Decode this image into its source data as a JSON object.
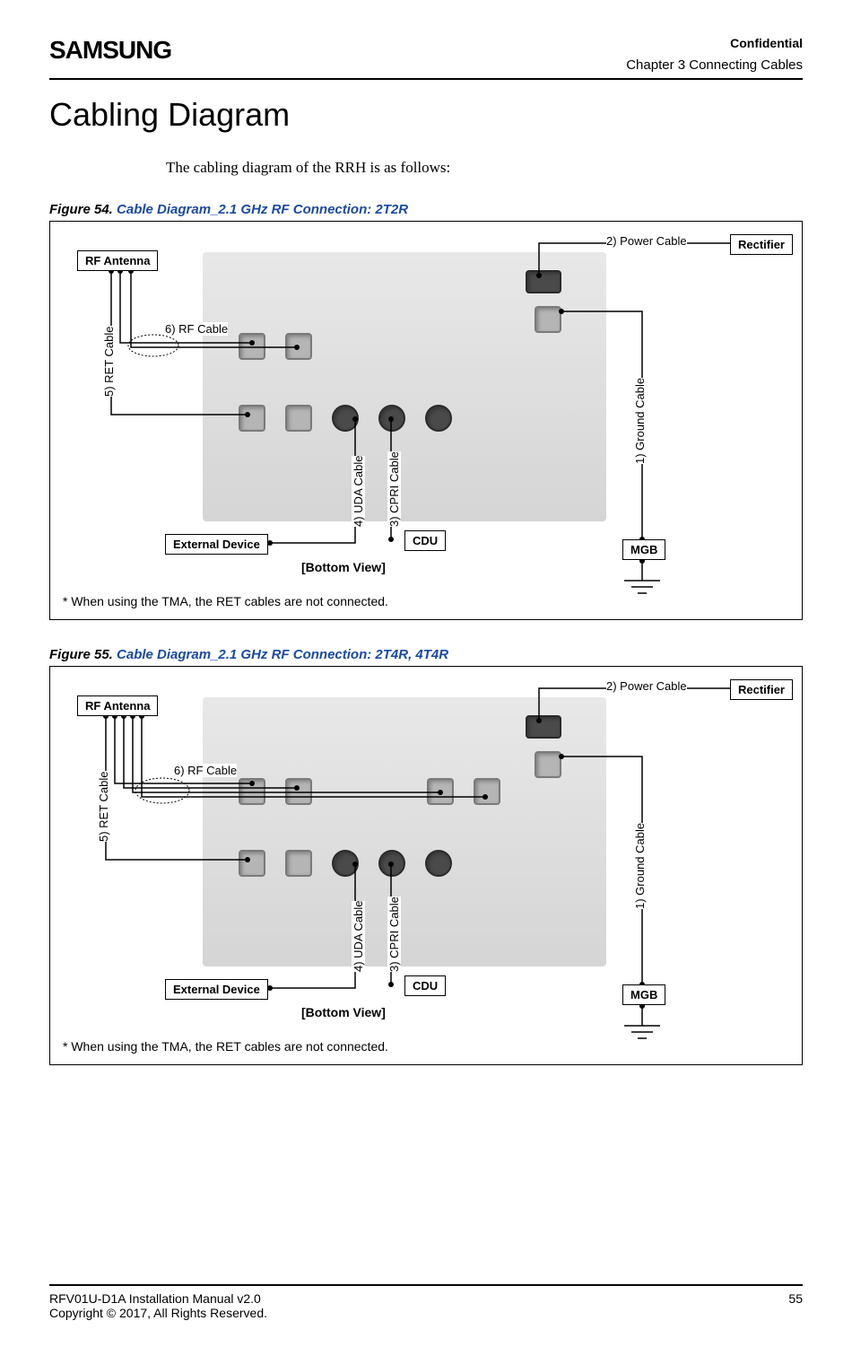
{
  "header": {
    "logo": "SAMSUNG",
    "confidential": "Confidential",
    "chapter": "Chapter 3 Connecting Cables"
  },
  "title": "Cabling Diagram",
  "intro": "The cabling diagram of the RRH is as follows:",
  "figures": [
    {
      "prefix": "Figure 54.",
      "title": "Cable Diagram_2.1 GHz RF Connection: 2T2R",
      "labels": {
        "rf_antenna": "RF Antenna",
        "rectifier": "Rectifier",
        "external_device": "External Device",
        "cdu": "CDU",
        "mgb": "MGB",
        "power_cable": "2)  Power Cable",
        "ground_cable": "1)  Ground Cable",
        "cpri_cable": "3)  CPRI Cable",
        "uda_cable": "4)  UDA Cable",
        "ret_cable": "5)  RET Cable",
        "rf_cable": "6)  RF Cable",
        "bottom_view": "[Bottom View]",
        "note": "* When using the TMA, the RET cables are not connected."
      }
    },
    {
      "prefix": "Figure 55.",
      "title": "Cable Diagram_2.1 GHz RF Connection: 2T4R, 4T4R",
      "labels": {
        "rf_antenna": "RF Antenna",
        "rectifier": "Rectifier",
        "external_device": "External Device",
        "cdu": "CDU",
        "mgb": "MGB",
        "power_cable": "2)  Power Cable",
        "ground_cable": "1)  Ground Cable",
        "cpri_cable": "3)  CPRI Cable",
        "uda_cable": "4)  UDA Cable",
        "ret_cable": "5)  RET Cable",
        "rf_cable": "6)  RF Cable",
        "bottom_view": "[Bottom View]",
        "note": "* When using the TMA, the RET cables are not connected."
      }
    }
  ],
  "footer": {
    "manual": "RFV01U-D1A Installation Manual   v2.0",
    "copyright": "Copyright © 2017, All Rights Reserved.",
    "page": "55"
  }
}
